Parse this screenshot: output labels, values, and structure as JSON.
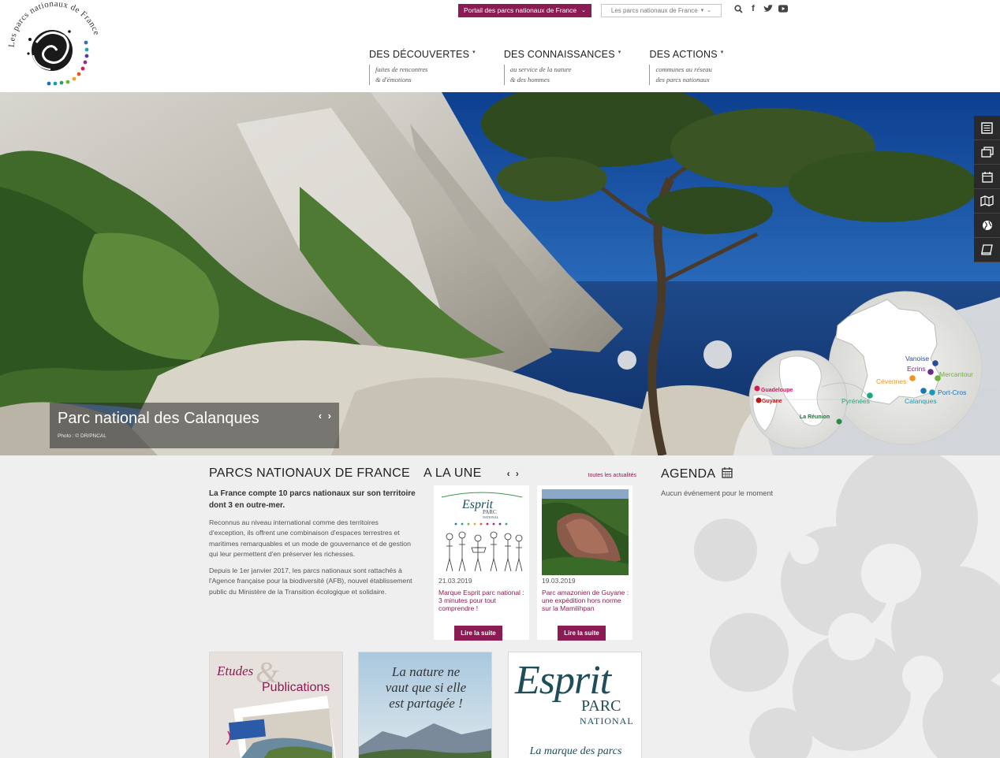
{
  "logo": {
    "text": "Les parcs nationaux de France"
  },
  "top_bar": {
    "portal_label": "Portail des parcs nationaux de France",
    "parks_select": "Les parcs nationaux de France",
    "icons": [
      "search-icon",
      "facebook-icon",
      "twitter-icon",
      "youtube-icon"
    ]
  },
  "nav": [
    {
      "title": "DES DÉCOUVERTES",
      "sub1": "faites de rencontres",
      "sub2": "& d'émotions"
    },
    {
      "title": "DES CONNAISSANCES",
      "sub1": "au service de la nature",
      "sub2": "& des hommes"
    },
    {
      "title": "DES ACTIONS",
      "sub1": "communes au réseau",
      "sub2": "des parcs nationaux"
    }
  ],
  "hero": {
    "caption": "Parc national des Calanques",
    "credit": "Photo : © DR/PNCAL",
    "arrows": "‹ ›",
    "map_labels": {
      "vanoise": "Vanoise",
      "ecrins": "Ecrins",
      "mercantour": "Mercantour",
      "cevennes": "Cévennes",
      "portcros": "Port-Cros",
      "pyrenees": "Pyrénées",
      "calanques": "Calanques",
      "guadeloupe": "Guadeloupe",
      "guyane": "Guyane",
      "reunion": "La Réunion"
    },
    "side_tools": [
      "newspaper-icon",
      "gallery-icon",
      "calendar-icon",
      "map-icon",
      "globe-icon",
      "book-icon"
    ]
  },
  "intro": {
    "title": "PARCS NATIONAUX DE FRANCE",
    "lead": "La France compte 10 parcs nationaux sur son territoire dont 3 en outre-mer.",
    "p1": "Reconnus au niveau international comme des territoires d'exception, ils offrent une combinaison d'espaces terrestres et maritimes remarquables et un mode de gouvernance et de gestion qui leur permettent d'en préserver les richesses.",
    "p2": "Depuis le 1er janvier 2017, les parcs nationaux sont rattachés à l'Agence française pour la biodiversité (AFB), nouvel établissement public du Ministère de la Transition écologique et solidaire."
  },
  "news": {
    "title": "A LA UNE",
    "arrows": "‹ ›",
    "all_link": "toutes les actualités",
    "items": [
      {
        "date": "21.03.2019",
        "title": "Marque Esprit parc national : 3 minutes pour tout comprendre !",
        "button": "Lire la suite",
        "img_esprit": "Esprit",
        "img_parc": "PARC",
        "img_national": "NATIONAL"
      },
      {
        "date": "19.03.2019",
        "title": "Parc amazonien de Guyane : une expédition hors norme sur la Mamilihpan",
        "button": "Lire la suite"
      }
    ]
  },
  "agenda": {
    "title": "AGENDA",
    "empty": "Aucun événement pour le moment"
  },
  "promos": {
    "etudes": "Etudes",
    "amp": "&",
    "publications": "Publications",
    "quote1": "La nature ne",
    "quote2": "vaut que si elle",
    "quote3": "est partagée !",
    "esprit": "Esprit",
    "parc": "PARC",
    "national": "NATIONAL",
    "marque": "La marque des parcs"
  }
}
